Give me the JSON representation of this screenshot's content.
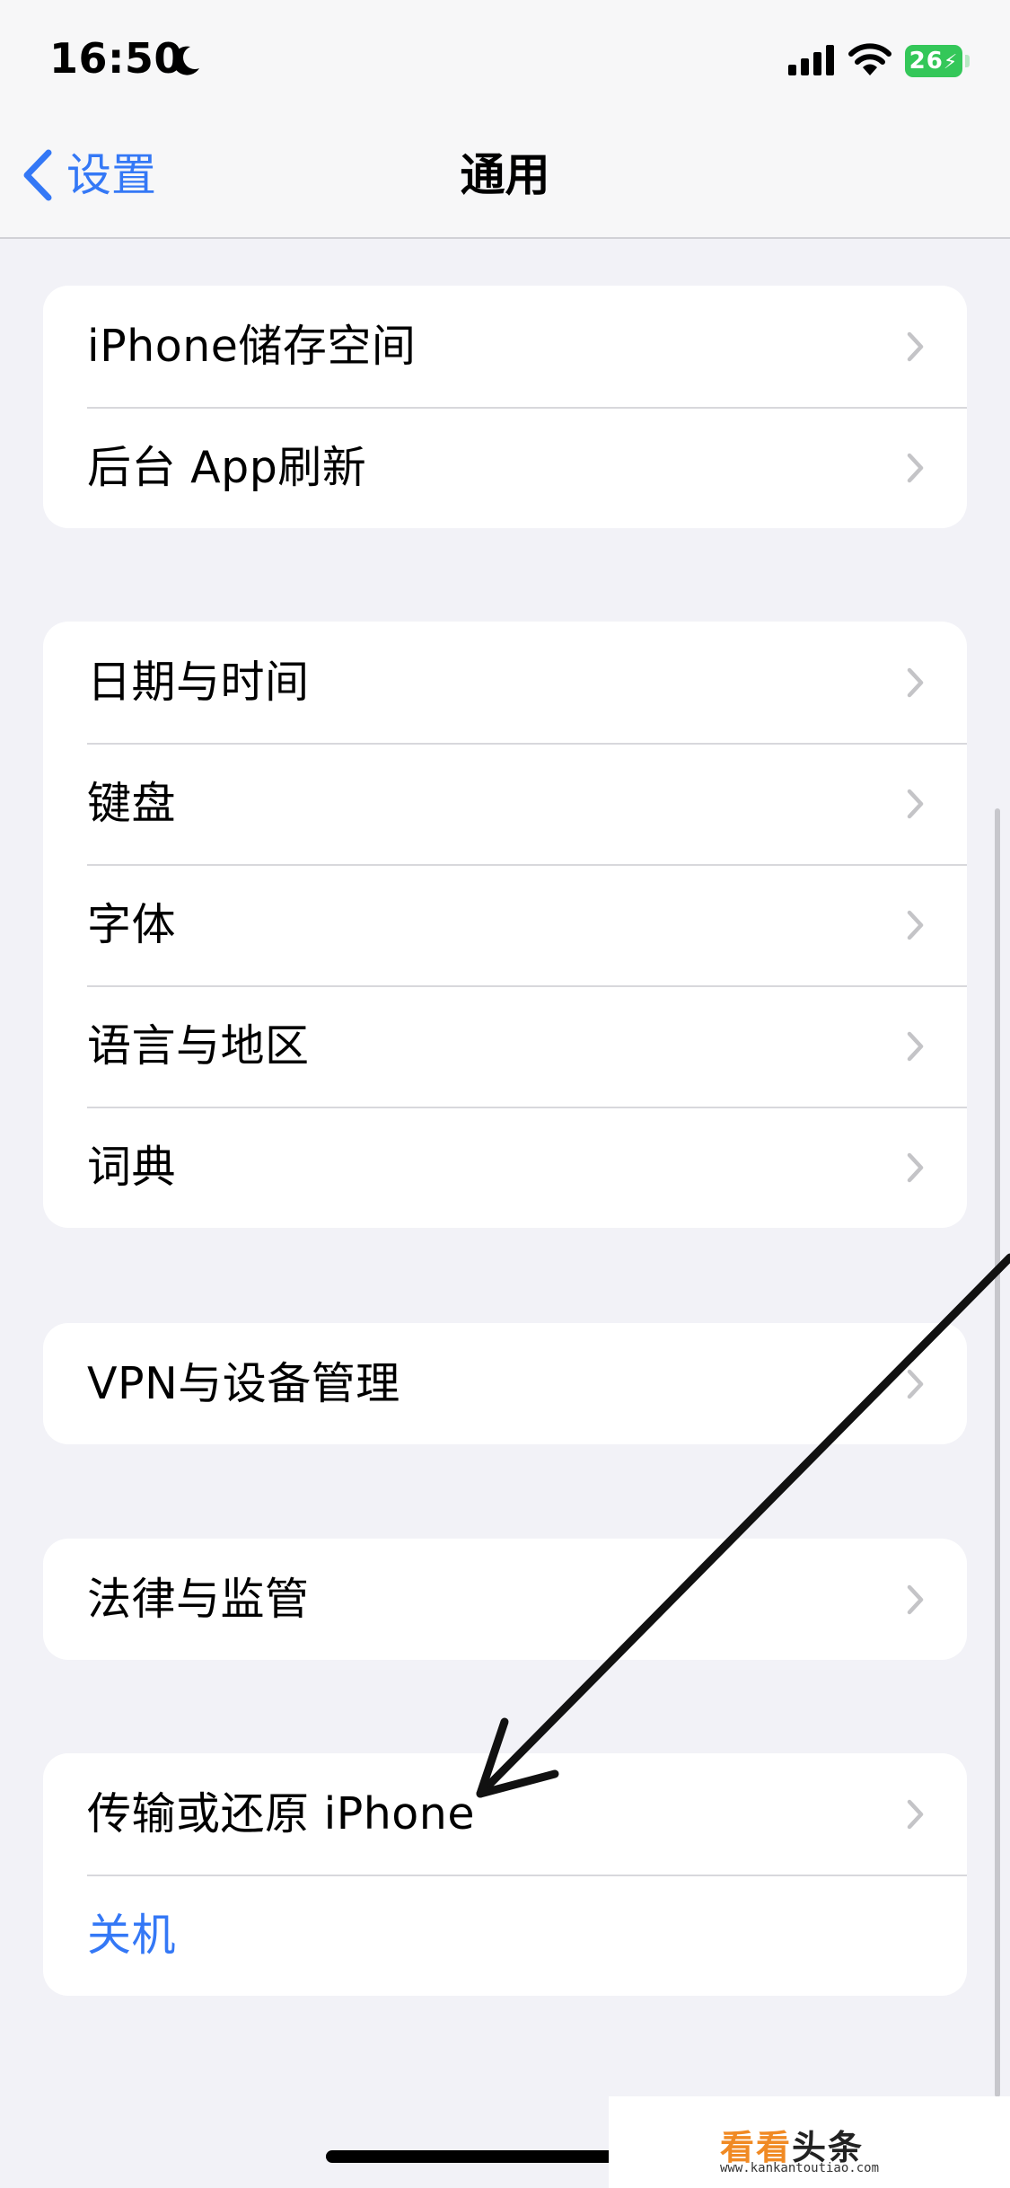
{
  "status_bar": {
    "time": "16:50",
    "battery_level": "26",
    "icons": [
      "moon-icon",
      "signal-icon",
      "wifi-icon",
      "battery-charging-icon"
    ]
  },
  "nav": {
    "back_label": "设置",
    "title": "通用"
  },
  "groups": [
    {
      "rows": [
        {
          "label": "iPhone储存空间"
        },
        {
          "label": "后台 App刷新"
        }
      ]
    },
    {
      "rows": [
        {
          "label": "日期与时间"
        },
        {
          "label": "键盘"
        },
        {
          "label": "字体"
        },
        {
          "label": "语言与地区"
        },
        {
          "label": "词典"
        }
      ]
    },
    {
      "rows": [
        {
          "label": "VPN与设备管理"
        }
      ]
    },
    {
      "rows": [
        {
          "label": "法律与监管"
        }
      ]
    },
    {
      "rows": [
        {
          "label": "传输或还原 iPhone"
        },
        {
          "label": "关机"
        }
      ]
    }
  ],
  "colors": {
    "accent": "#3478f6",
    "background": "#f2f2f7",
    "battery": "#34c759"
  },
  "watermark": {
    "logo_part1": "看看",
    "logo_part2": "头条",
    "url": "www.kankantoutiao.com"
  }
}
